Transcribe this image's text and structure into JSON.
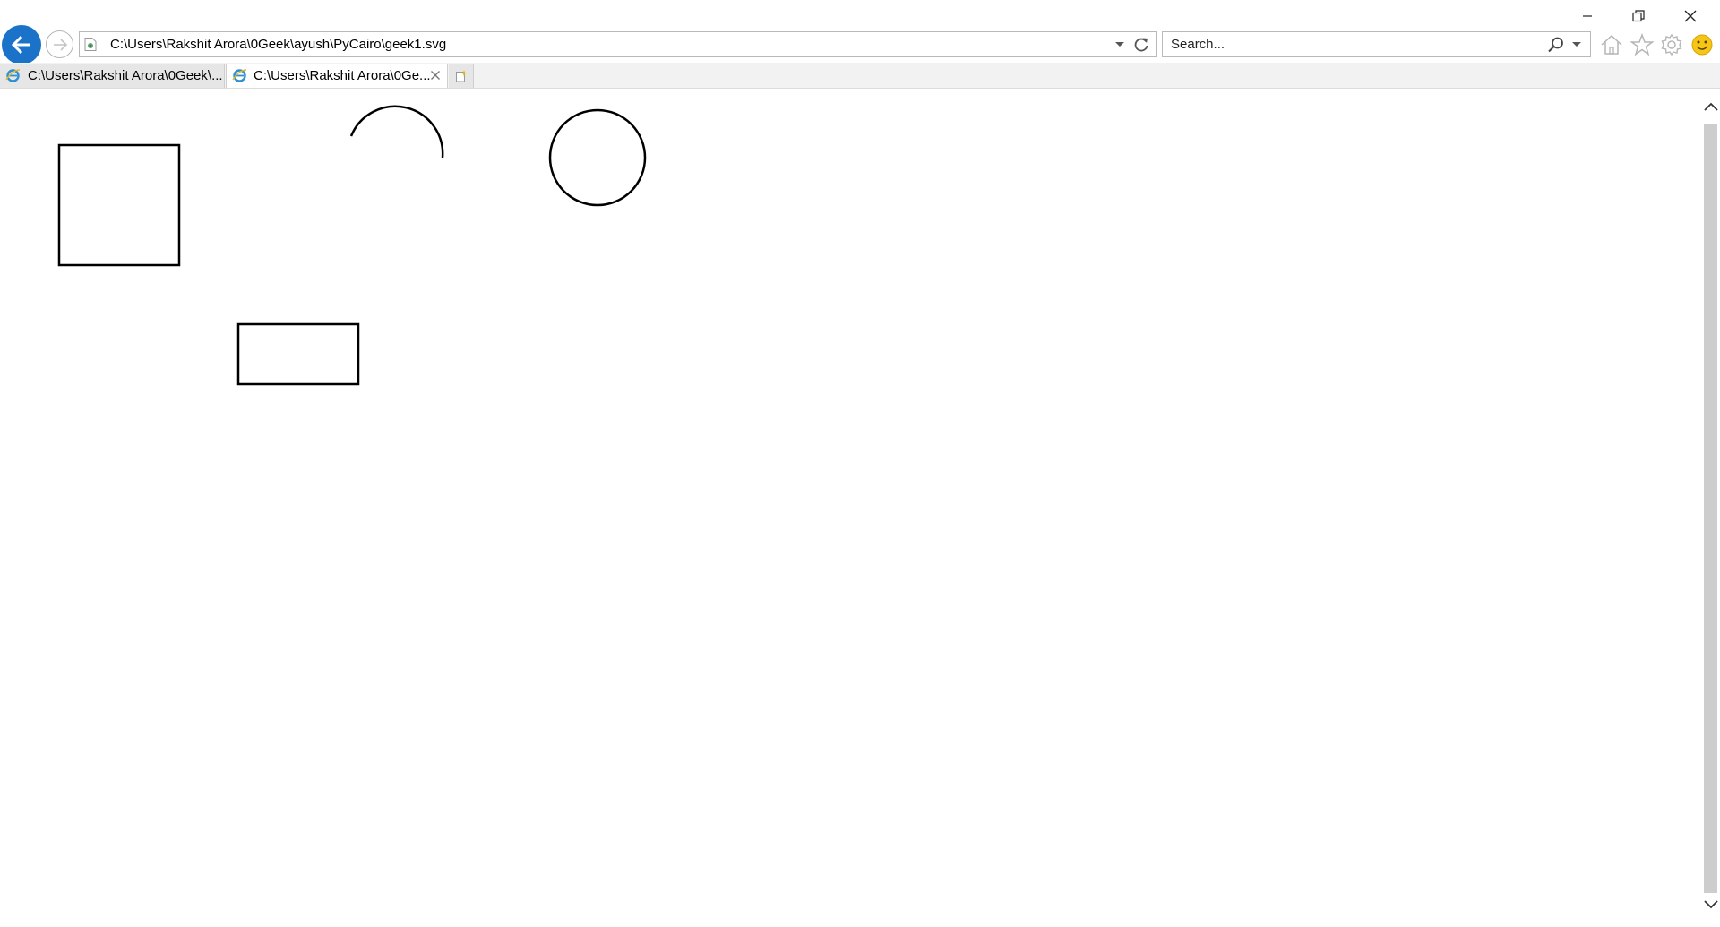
{
  "window": {
    "controls": [
      "minimize-icon",
      "restore-icon",
      "close-icon"
    ]
  },
  "toolbar": {
    "back_icon": "back-arrow-icon",
    "forward_icon": "forward-arrow-icon",
    "address_url": "C:\\Users\\Rakshit Arora\\0Geek\\ayush\\PyCairo\\geek1.svg",
    "search_placeholder": "Search...",
    "tools": [
      "home-icon",
      "favorites-star-icon",
      "settings-gear-icon",
      "feedback-smiley-icon"
    ]
  },
  "tabs": [
    {
      "title": "C:\\Users\\Rakshit Arora\\0Geek\\...",
      "active": false
    },
    {
      "title": "C:\\Users\\Rakshit Arora\\0Ge...",
      "active": true
    }
  ],
  "colors": {
    "accent": "#1a73c9",
    "smiley": "#f5c518",
    "stroke": "#000000"
  },
  "canvas": {
    "shapes": [
      "square",
      "arc",
      "circle",
      "rectangle"
    ]
  }
}
